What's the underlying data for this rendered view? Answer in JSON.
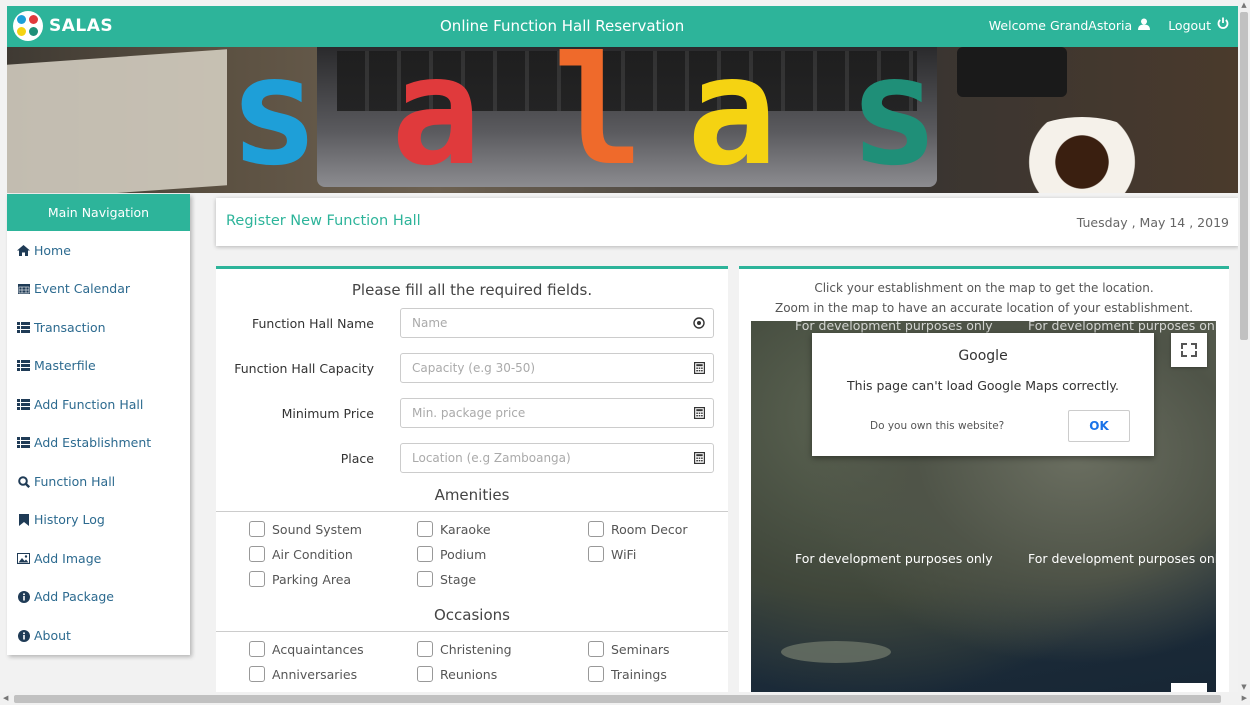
{
  "topbar": {
    "brand": "SALAS",
    "title": "Online Function Hall Reservation",
    "welcome": "Welcome GrandAstoria",
    "logout": "Logout"
  },
  "banner": {
    "letters": [
      {
        "char": "s",
        "color": "#1e9fd8"
      },
      {
        "char": "a",
        "color": "#e03a3c"
      },
      {
        "char": "l",
        "color": "#ef6a2b"
      },
      {
        "char": "a",
        "color": "#f5d312"
      },
      {
        "char": "s",
        "color": "#1f8f78"
      }
    ]
  },
  "sidebar": {
    "heading": "Main Navigation",
    "items": [
      {
        "label": "Home",
        "icon": "home-icon"
      },
      {
        "label": "Event Calendar",
        "icon": "calendar-icon"
      },
      {
        "label": "Transaction",
        "icon": "list-icon"
      },
      {
        "label": "Masterfile",
        "icon": "list-icon"
      },
      {
        "label": "Add Function Hall",
        "icon": "list-icon"
      },
      {
        "label": "Add Establishment",
        "icon": "list-icon"
      },
      {
        "label": "Function Hall",
        "icon": "search-icon"
      },
      {
        "label": "History Log",
        "icon": "bookmark-icon"
      },
      {
        "label": "Add Image",
        "icon": "image-icon"
      },
      {
        "label": "Add Package",
        "icon": "info-icon"
      },
      {
        "label": "About",
        "icon": "info-icon"
      }
    ]
  },
  "header": {
    "title": "Register New Function Hall",
    "date": "Tuesday , May 14 , 2019"
  },
  "form": {
    "intro": "Please fill all the required fields.",
    "fields": [
      {
        "label": "Function Hall Name",
        "placeholder": "Name",
        "value": ""
      },
      {
        "label": "Function Hall Capacity",
        "placeholder": "Capacity (e.g 30-50)",
        "value": ""
      },
      {
        "label": "Minimum Price",
        "placeholder": "Min. package price",
        "value": ""
      },
      {
        "label": "Place",
        "placeholder": "Location (e.g Zamboanga)",
        "value": ""
      }
    ],
    "amenities_title": "Amenities",
    "amenities": [
      "Sound System",
      "Karaoke",
      "Room Decor",
      "Air Condition",
      "Podium",
      "WiFi",
      "Parking Area",
      "Stage"
    ],
    "occasions_title": "Occasions",
    "occasions": [
      "Acquaintances",
      "Christening",
      "Seminars",
      "Anniversaries",
      "Reunions",
      "Trainings"
    ]
  },
  "map": {
    "hint1": "Click your establishment on the map to get the location.",
    "hint2": "Zoom in the map to have an accurate location of your establishment.",
    "dev_text": "For development purposes only",
    "dialog_title": "Google",
    "dialog_message": "This page can't load Google Maps correctly.",
    "dialog_own": "Do you own this website?",
    "dialog_ok": "OK"
  }
}
